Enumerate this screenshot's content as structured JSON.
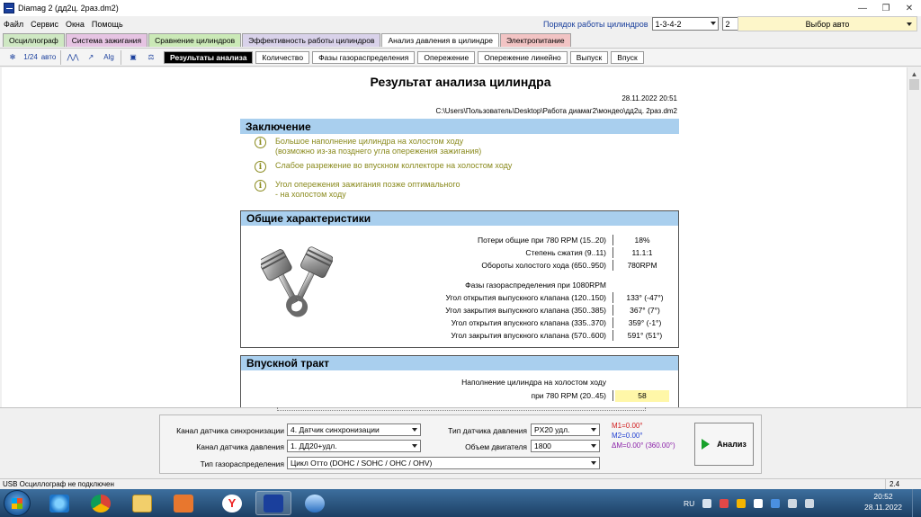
{
  "window": {
    "title": "Diamag 2 (дд2ц. 2раз.dm2)",
    "controls": [
      "—",
      "❐",
      "✕"
    ]
  },
  "menu": {
    "items": [
      "Файл",
      "Сервис",
      "Окна",
      "Помощь"
    ],
    "cylinder_order_label": "Порядок работы цилиндров",
    "cylinder_order_value": "1-3-4-2",
    "cylinder_value": "2",
    "select_auto": "Выбор авто"
  },
  "module_tabs": [
    {
      "label": "Осциллограф",
      "color": "#cfe8c3"
    },
    {
      "label": "Система зажигания",
      "color": "#e6c4e3"
    },
    {
      "label": "Сравнение цилиндров",
      "color": "#cbe9b7"
    },
    {
      "label": "Эффективность работы цилиндров",
      "color": "#d9d2ea"
    },
    {
      "label": "Анализ давления в цилиндре",
      "color": "#ffffff"
    },
    {
      "label": "Электропитание",
      "color": "#f2c4c4"
    }
  ],
  "toolbar": {
    "icons": [
      {
        "name": "gear-icon",
        "glyph": "✻"
      },
      {
        "name": "cylinder-number-icon",
        "glyph": "1/24"
      },
      {
        "name": "auto-icon",
        "glyph": "авто"
      },
      {
        "name": "waveform-icon",
        "glyph": "⋀⋀"
      },
      {
        "name": "chart-icon",
        "glyph": "↗"
      },
      {
        "name": "algorithm-icon",
        "glyph": "Alg"
      },
      {
        "name": "save-icon",
        "glyph": "▣"
      },
      {
        "name": "scales-icon",
        "glyph": "⚖"
      }
    ],
    "subtabs": [
      "Результаты анализа",
      "Количество",
      "Фазы газораспределения",
      "Опережение",
      "Опережение линейно",
      "Выпуск",
      "Впуск"
    ]
  },
  "report": {
    "title": "Результат анализа цилиндра",
    "datetime": "28.11.2022 20:51",
    "path": "C:\\Users\\Пользователь\\Desktop\\Работа диамаг2\\мондео\\дд2ц. 2раз.dm2",
    "conclusion": {
      "heading": "Заключение",
      "items": [
        {
          "line1": "Большое наполнение цилиндра на холостом ходу",
          "line2": "(возможно из-за позднего угла опережения зажигания)"
        },
        {
          "line1": "Слабое разрежение во впускном коллекторе на холостом ходу",
          "line2": ""
        },
        {
          "line1": "Угол опережения зажигания позже оптимального",
          "line2": "- на холостом ходу"
        }
      ]
    },
    "general": {
      "heading": "Общие характеристики",
      "rows": [
        {
          "label": "Потери общие при 780 RPM (15..20)",
          "value": "18%"
        },
        {
          "label": "Степень сжатия (9..11)",
          "value": "11.1:1"
        },
        {
          "label": "Обороты холостого хода (650..950)",
          "value": "780RPM"
        }
      ],
      "phases_title": "Фазы газораспределения при 1080RPM",
      "phases": [
        {
          "label": "Угол открытия выпускного клапана (120..150)",
          "value": "133°  (-47°)"
        },
        {
          "label": "Угол закрытия выпускного клапана (350..385)",
          "value": "367°    (7°)"
        },
        {
          "label": "Угол открытия впускного клапана (335..370)",
          "value": "359°  (-1°)"
        },
        {
          "label": "Угол закрытия впускного клапана (570..600)",
          "value": "591°  (51°)"
        }
      ]
    },
    "intake": {
      "heading": "Впускной тракт",
      "fill_label1": "Наполнение цилиндра на холостом ходу",
      "fill_label2": "при 780 RPM (20..45)",
      "fill_value": "58"
    }
  },
  "bottom": {
    "sync_channel_label": "Канал датчика синхронизации",
    "sync_channel_value": "4.  Датчик синхронизации",
    "pressure_channel_label": "Канал датчика давления",
    "pressure_channel_value": "1.  ДД20+удл.",
    "timing_type_label": "Тип газораспределения",
    "timing_type_value": "Цикл Отто (DOHC / SOHC / OHC / OHV)",
    "pressure_sensor_label": "Тип датчика давления",
    "pressure_sensor_value": "PX20 удл.",
    "engine_volume_label": "Объем двигателя",
    "engine_volume_value": "1800",
    "markers": {
      "m1": "M1=0.00°",
      "m2": "M2=0.00°",
      "dm": "ΔM=0.00° (360.00°)"
    },
    "analyze_label": "Анализ"
  },
  "status": {
    "text": "USB Осциллограф не подключен",
    "version": "2.4"
  },
  "taskbar": {
    "lang": "RU",
    "time": "20:52",
    "date": "28.11.2022"
  },
  "colors": {
    "section_header": "#a9cfee",
    "conclusion_text": "#8a8a1d",
    "highlight_value": "#fff7a8",
    "m1": "#d11f1f",
    "m2": "#1f3fd1",
    "dm": "#8a1fa8"
  }
}
